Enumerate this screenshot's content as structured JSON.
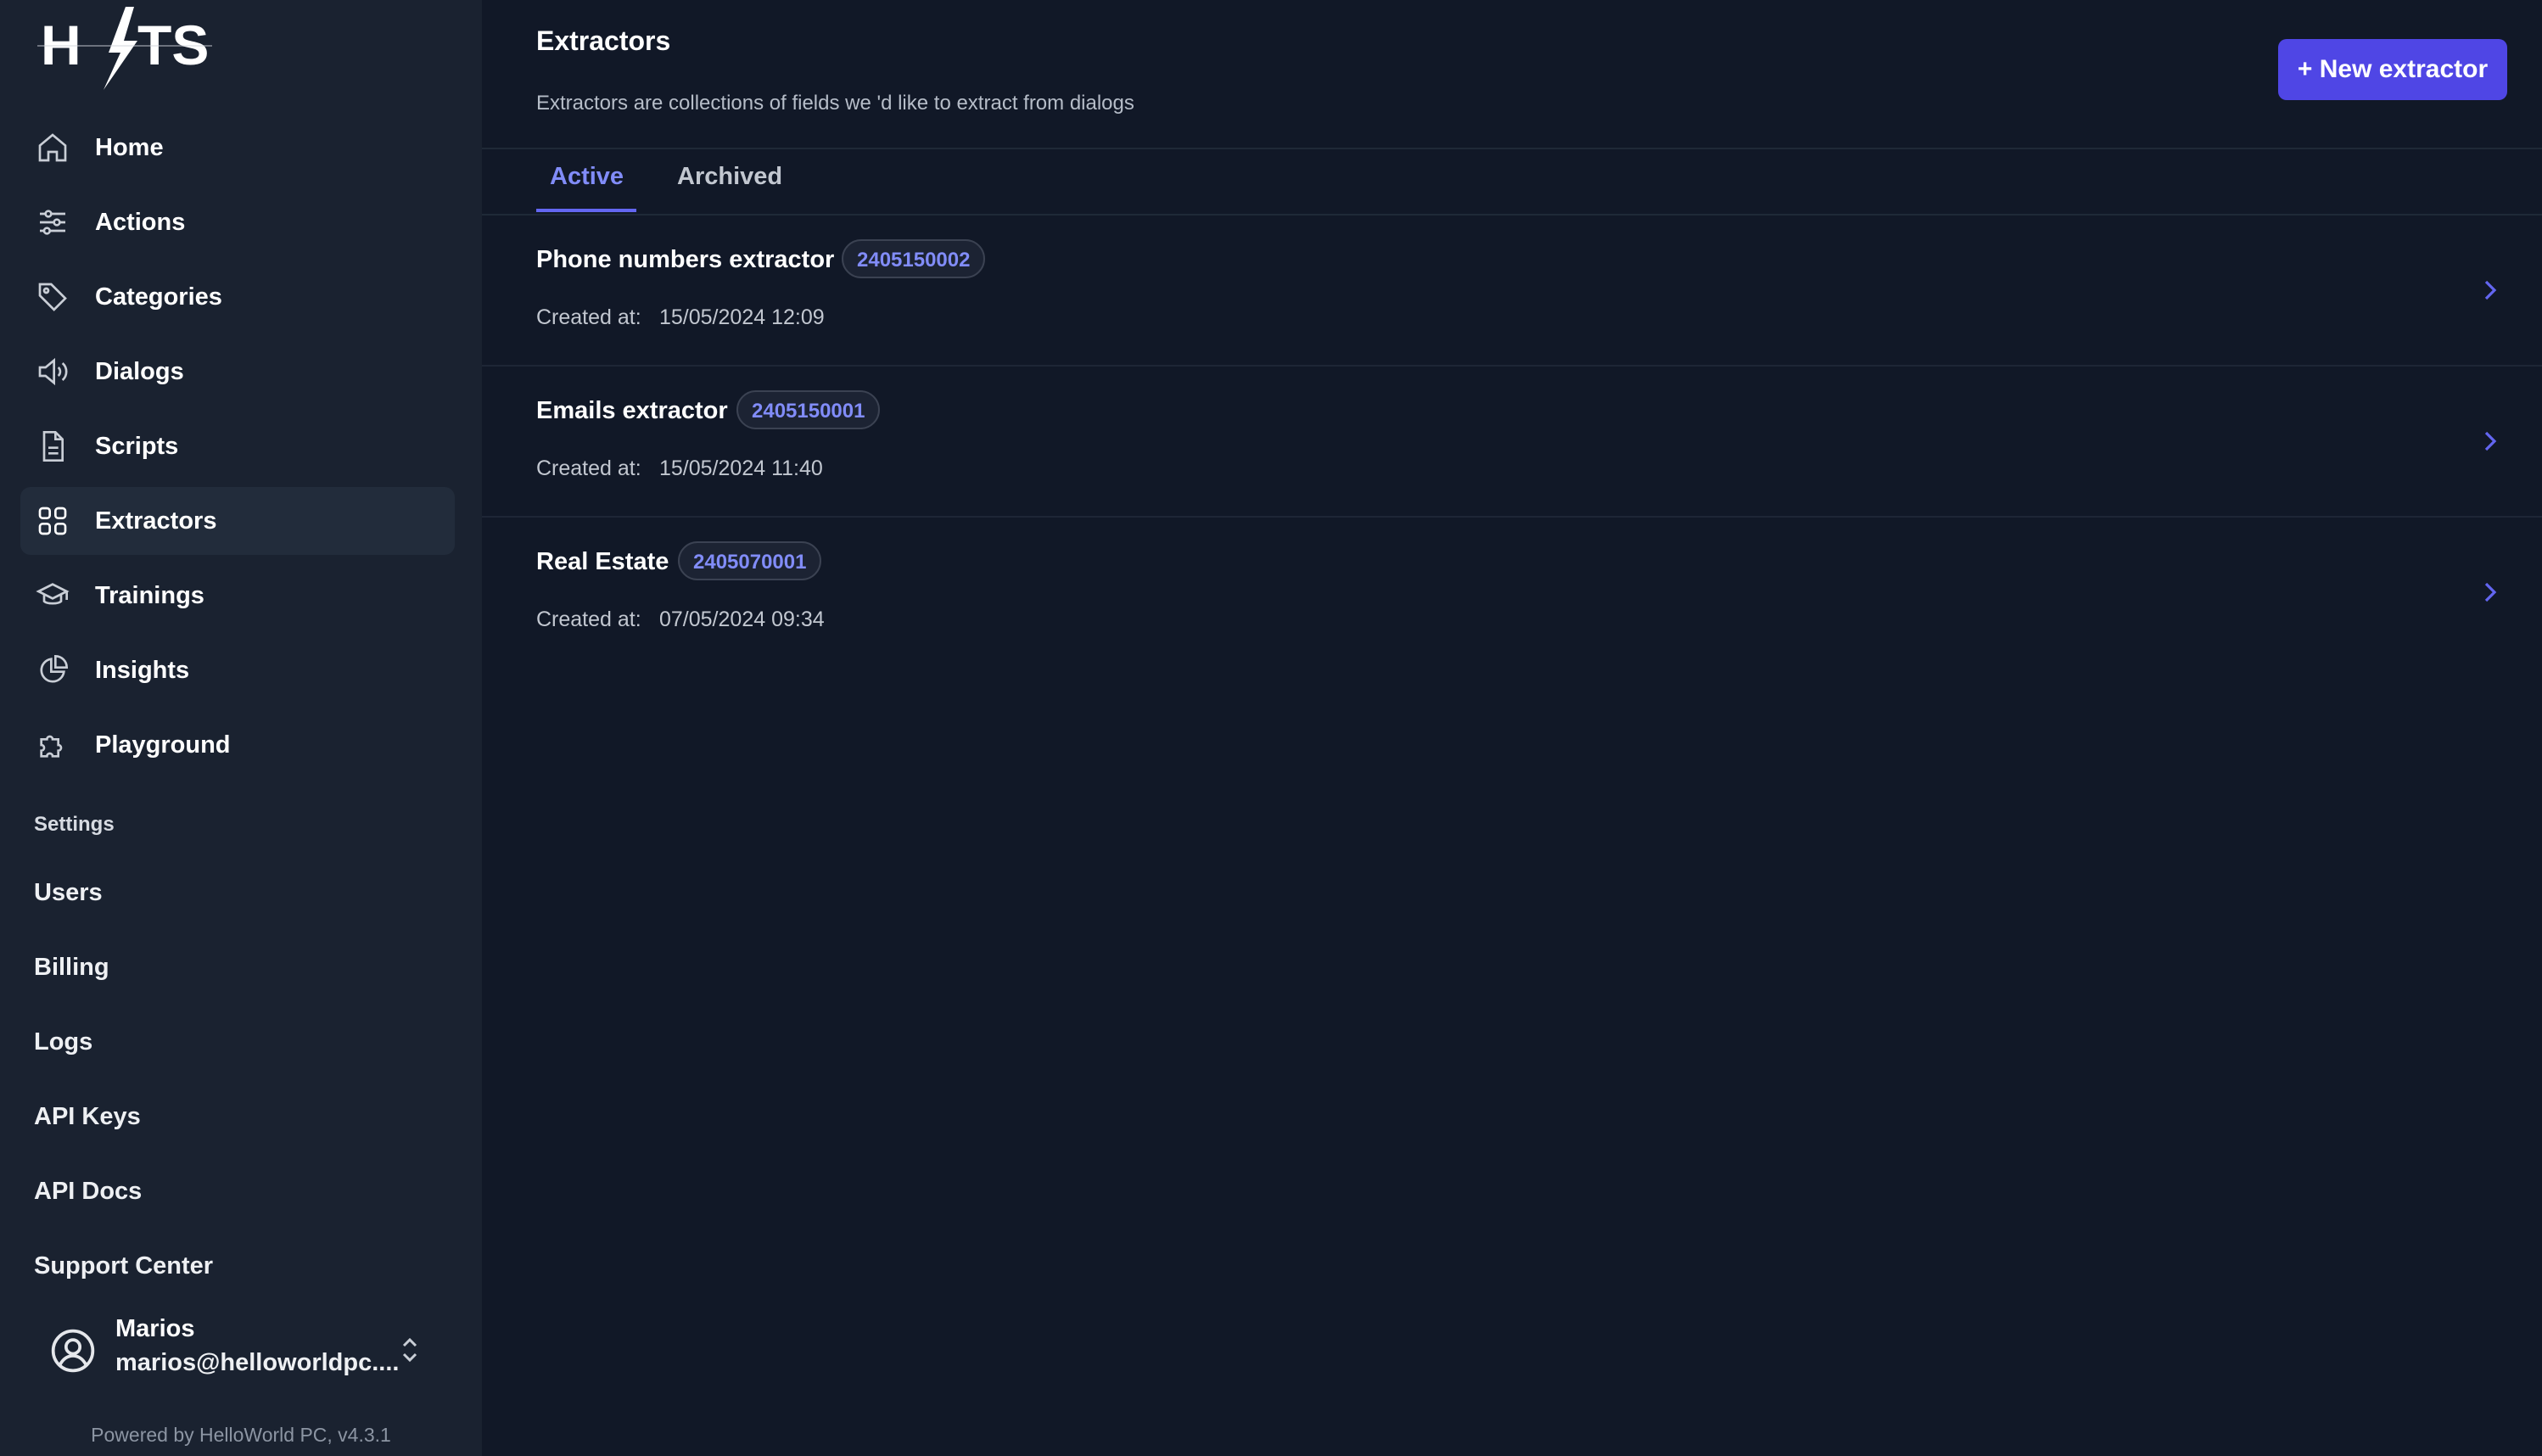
{
  "brand": {
    "logo_text": "HITS"
  },
  "sidebar": {
    "items": [
      {
        "label": "Home",
        "icon": "home-icon"
      },
      {
        "label": "Actions",
        "icon": "sliders-icon"
      },
      {
        "label": "Categories",
        "icon": "tag-icon"
      },
      {
        "label": "Dialogs",
        "icon": "speaker-icon"
      },
      {
        "label": "Scripts",
        "icon": "document-icon"
      },
      {
        "label": "Extractors",
        "icon": "grid-icon",
        "active": true
      },
      {
        "label": "Trainings",
        "icon": "graduation-cap-icon"
      },
      {
        "label": "Insights",
        "icon": "pie-chart-icon"
      },
      {
        "label": "Playground",
        "icon": "puzzle-icon"
      }
    ],
    "settings_heading": "Settings",
    "settings_items": [
      "Users",
      "Billing",
      "Logs",
      "API Keys",
      "API Docs",
      "Support Center"
    ],
    "user": {
      "name": "Marios",
      "email": "marios@helloworldpc...."
    },
    "powered_by": "Powered by HelloWorld PC, v4.3.1"
  },
  "page": {
    "title": "Extractors",
    "subtitle": "Extractors are collections of fields we 'd like to extract from dialogs",
    "new_button": "+ New extractor",
    "tabs": [
      {
        "label": "Active",
        "active": true
      },
      {
        "label": "Archived",
        "active": false
      }
    ]
  },
  "extractors": [
    {
      "name": "Phone numbers extractor",
      "id": "2405150002",
      "created_label": "Created at:",
      "created_at": "15/05/2024 12:09"
    },
    {
      "name": "Emails extractor",
      "id": "2405150001",
      "created_label": "Created at:",
      "created_at": "15/05/2024 11:40"
    },
    {
      "name": "Real Estate",
      "id": "2405070001",
      "created_label": "Created at:",
      "created_at": "07/05/2024 09:34"
    }
  ],
  "colors": {
    "accent": "#4f46e5",
    "accent_text": "#818cf8",
    "background": "#111827",
    "sidebar": "#1a2230"
  }
}
